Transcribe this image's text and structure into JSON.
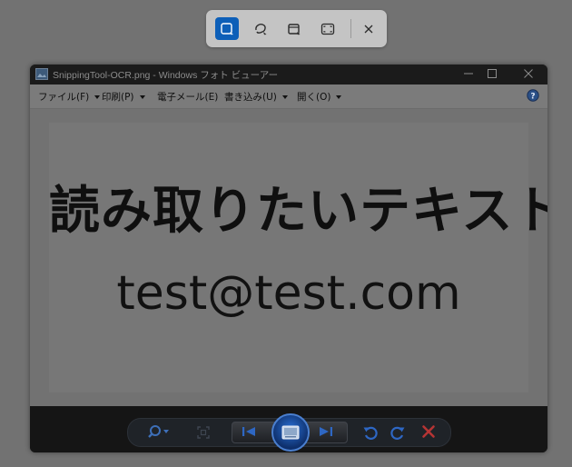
{
  "snip_toolbar": {
    "buttons": [
      {
        "icon": "rectangle-snip-icon",
        "active": true
      },
      {
        "icon": "freeform-snip-icon",
        "active": false
      },
      {
        "icon": "window-snip-icon",
        "active": false
      },
      {
        "icon": "fullscreen-snip-icon",
        "active": false
      }
    ],
    "close_icon": "close-icon"
  },
  "window": {
    "title": "SnippingTool-OCR.png - Windows フォト ビューアー",
    "menu": [
      {
        "label": "ファイル(F)",
        "has_arrow": true
      },
      {
        "label": "印刷(P)",
        "has_arrow": true
      },
      {
        "label": "電子メール(E)",
        "has_arrow": false
      },
      {
        "label": "書き込み(U)",
        "has_arrow": true
      },
      {
        "label": "開く(O)",
        "has_arrow": true
      }
    ],
    "help_icon": "help-icon"
  },
  "image": {
    "heading": "読み取りたいテキスト",
    "email": "test@test.com"
  },
  "colors": {
    "accent": "#0d5fb8",
    "overlay": "#727272",
    "delete": "#c23a3a"
  }
}
